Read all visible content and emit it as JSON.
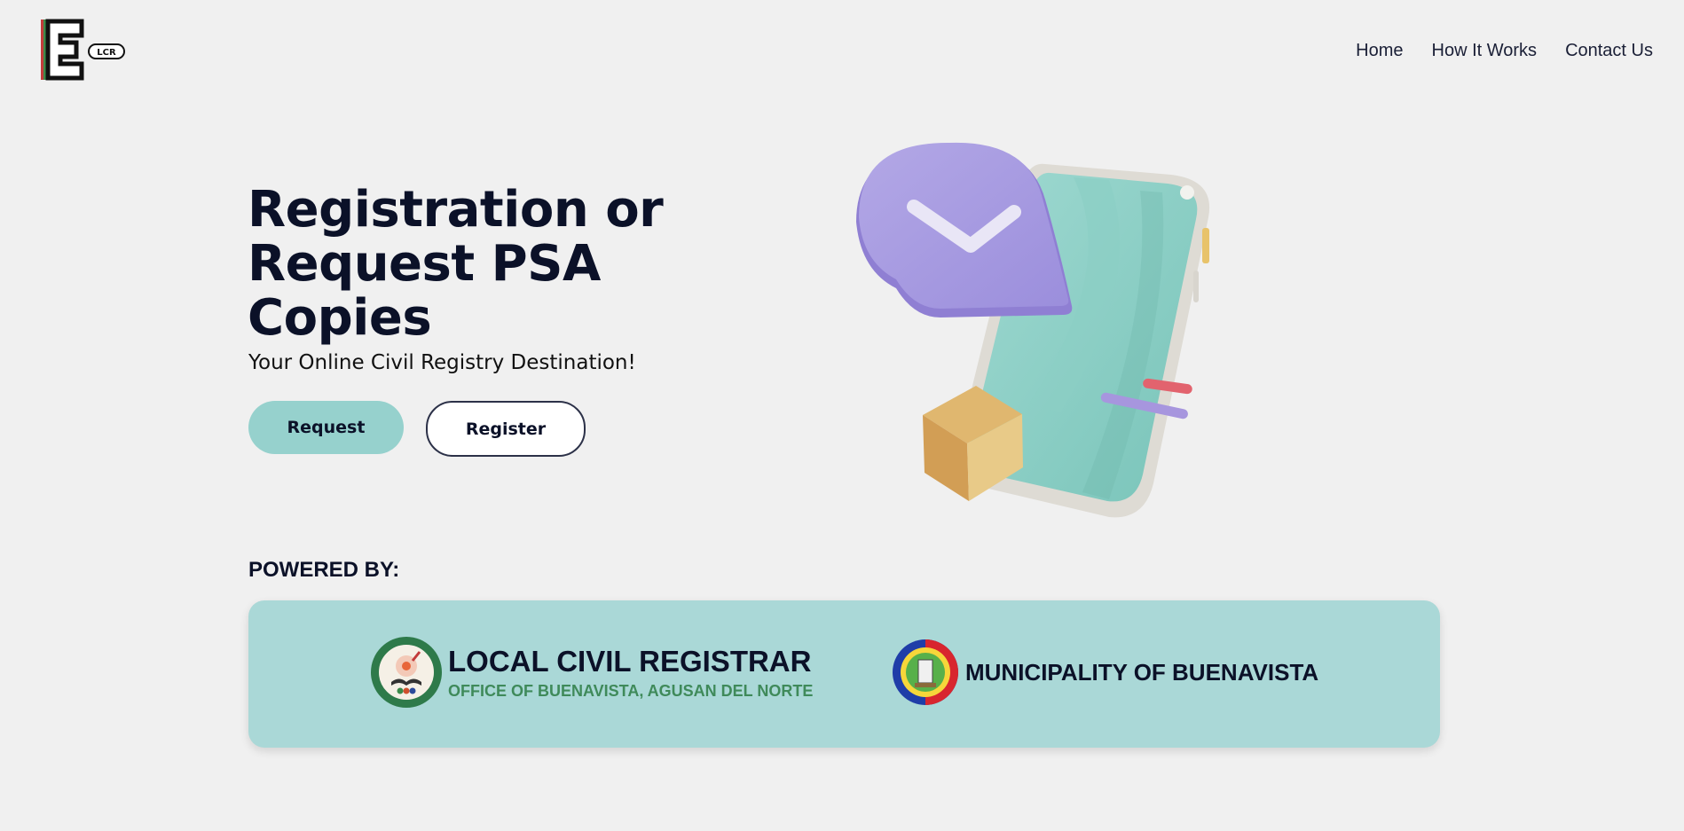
{
  "header": {
    "logo_text": "LCR",
    "nav": [
      "Home",
      "How It Works",
      "Contact Us"
    ]
  },
  "hero": {
    "title": "Registration or Request PSA Copies",
    "subtitle": "Your Online Civil Registry Destination!",
    "request_label": "Request",
    "register_label": "Register"
  },
  "powered_by": {
    "label": "POWERED BY:",
    "lcr_title": "LOCAL CIVIL REGISTRAR",
    "lcr_subtitle": "OFFICE OF BUENAVISTA, AGUSAN DEL NORTE",
    "municipality_title": "MUNICIPALITY OF BUENAVISTA"
  },
  "colors": {
    "background": "#f0f0f0",
    "accent": "#96d1cd",
    "partners_bg": "#aad8d7",
    "text": "#0b1128",
    "green": "#3f8a5a"
  },
  "icons": [
    "e-lcr-logo",
    "checkmark-chat-bubble-illustration",
    "lcr-seal-icon",
    "buenavista-seal-icon"
  ]
}
